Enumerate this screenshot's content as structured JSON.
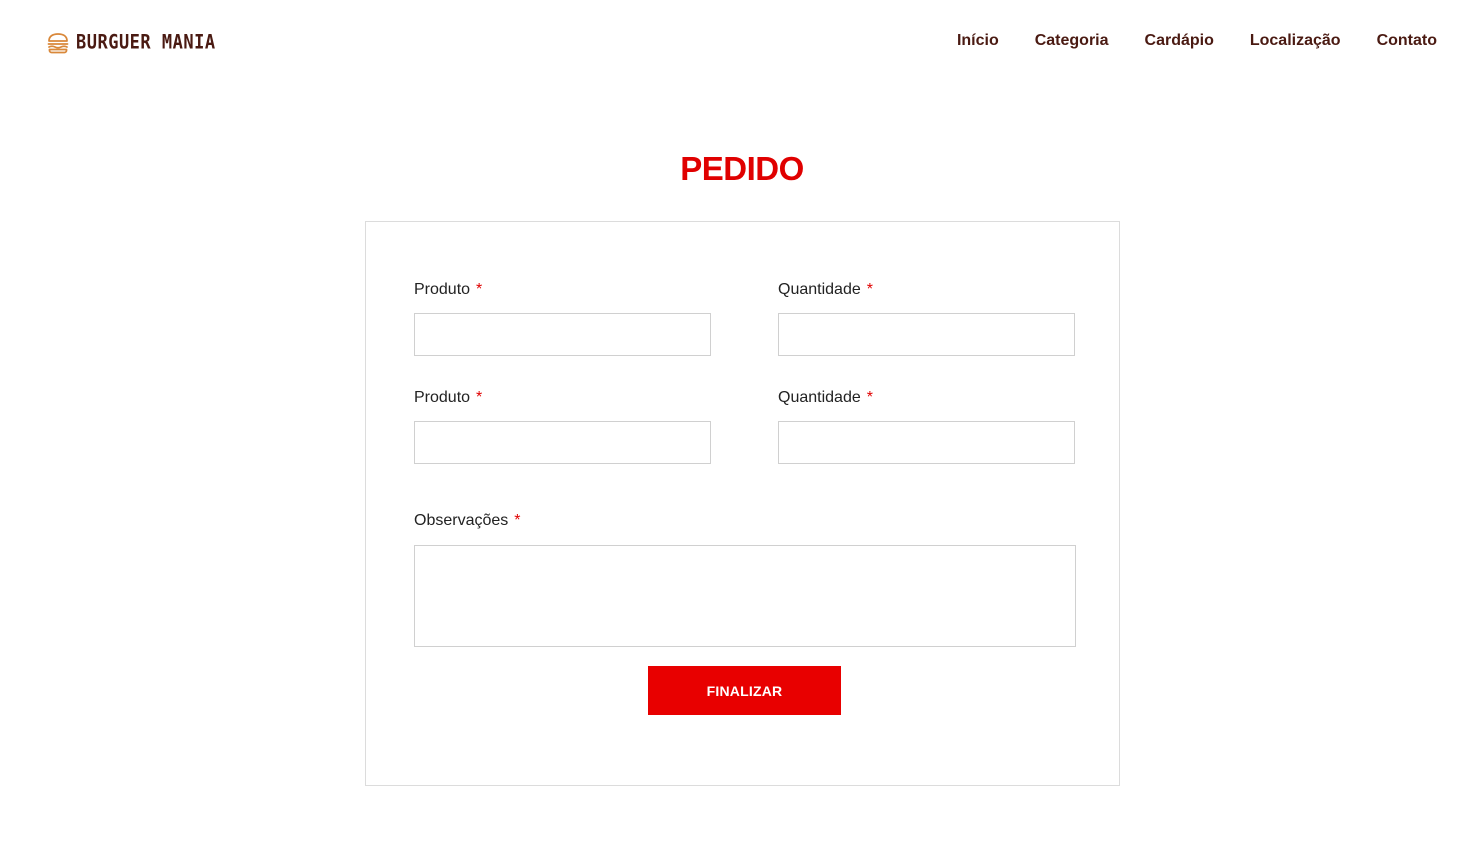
{
  "header": {
    "logo_text": "BURGUER MANIA",
    "logo_icon": "burger-icon",
    "nav": [
      {
        "label": "Início"
      },
      {
        "label": "Categoria"
      },
      {
        "label": "Cardápio"
      },
      {
        "label": "Localização"
      },
      {
        "label": "Contato"
      }
    ]
  },
  "page": {
    "title": "PEDIDO"
  },
  "form": {
    "rows": [
      {
        "product_label": "Produto",
        "product_value": "",
        "quantity_label": "Quantidade",
        "quantity_value": ""
      },
      {
        "product_label": "Produto",
        "product_value": "",
        "quantity_label": "Quantidade",
        "quantity_value": ""
      }
    ],
    "notes_label": "Observações",
    "notes_value": "",
    "required_mark": "*",
    "submit_label": "FINALIZAR"
  },
  "colors": {
    "brand_brown": "#4a1a12",
    "accent_red": "#e00000",
    "logo_orange": "#d9883a",
    "border_gray": "#d0d0d0"
  }
}
